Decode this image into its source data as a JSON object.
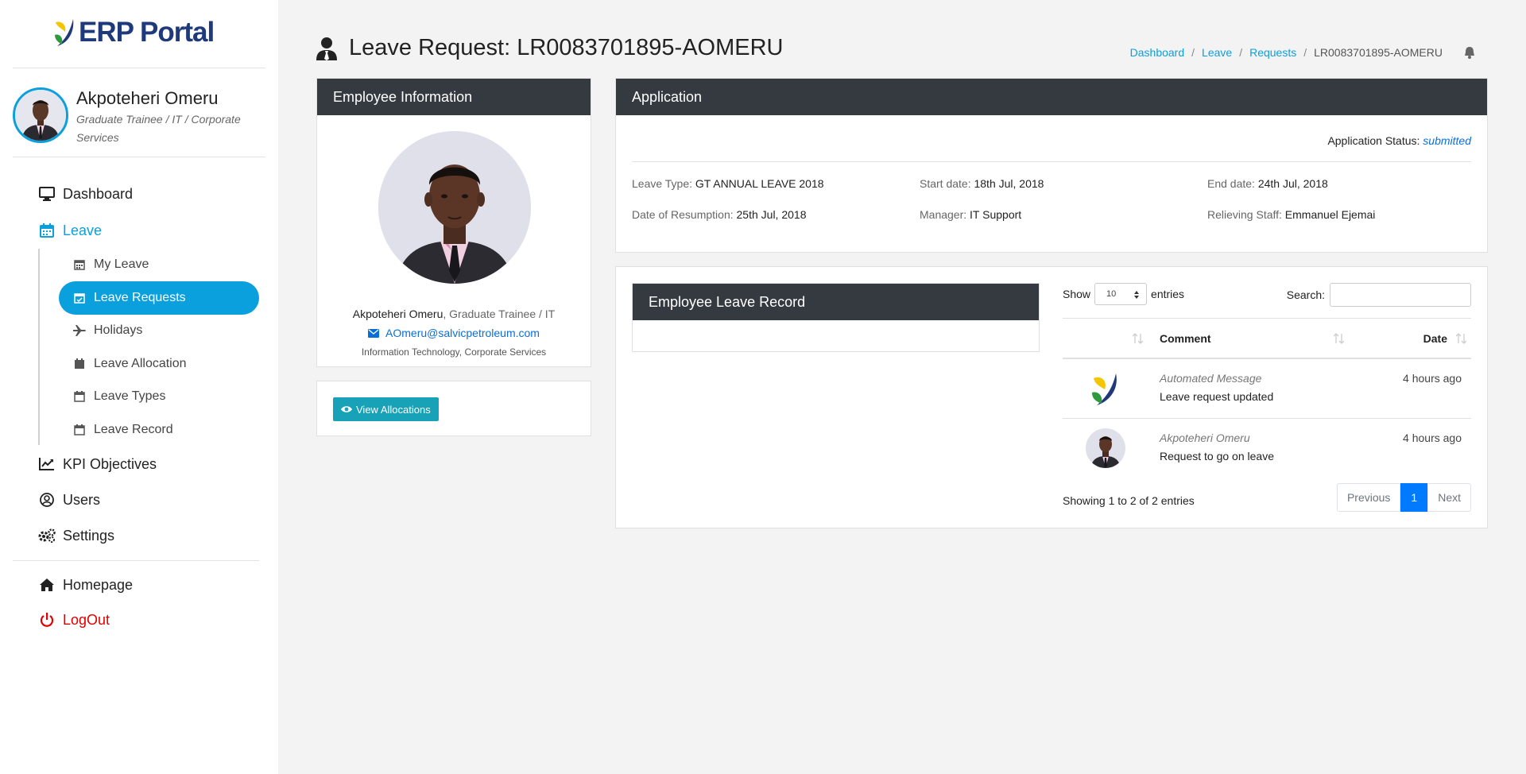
{
  "brand": {
    "name": "ERP Portal"
  },
  "user": {
    "name": "Akpoteheri Omeru",
    "role": "Graduate Trainee / IT / Corporate Services"
  },
  "nav": {
    "dashboard": "Dashboard",
    "leave": "Leave",
    "sub": {
      "my_leave": "My Leave",
      "leave_requests": "Leave Requests",
      "holidays": "Holidays",
      "leave_allocation": "Leave Allocation",
      "leave_types": "Leave Types",
      "leave_record": "Leave Record"
    },
    "kpi": "KPI Objectives",
    "users": "Users",
    "settings": "Settings",
    "homepage": "Homepage",
    "logout": "LogOut"
  },
  "page": {
    "title": "Leave Request: LR0083701895-AOMERU"
  },
  "breadcrumb": {
    "dashboard": "Dashboard",
    "leave": "Leave",
    "requests": "Requests",
    "current": "LR0083701895-AOMERU",
    "sep": "/"
  },
  "employee": {
    "header": "Employee Information",
    "name": "Akpoteheri Omeru",
    "title_suffix": ", Graduate Trainee / IT",
    "email": "AOmeru@salvicpetroleum.com",
    "department": "Information Technology, Corporate Services",
    "view_allocations": "View Allocations"
  },
  "application": {
    "header": "Application",
    "status_label": "Application Status:",
    "status_value": "submitted",
    "leave_type_label": "Leave Type:",
    "leave_type": "GT ANNUAL LEAVE 2018",
    "start_label": "Start date:",
    "start_date": "18th Jul, 2018",
    "end_label": "End date:",
    "end_date": "24th Jul, 2018",
    "resumption_label": "Date of Resumption:",
    "resumption_date": "25th Jul, 2018",
    "manager_label": "Manager:",
    "manager": "IT Support",
    "relieving_label": "Relieving Staff:",
    "relieving_staff": "Emmanuel Ejemai"
  },
  "record": {
    "header": "Employee Leave Record",
    "show_label": "Show",
    "entries_value": "10",
    "entries_label": "entries",
    "search_label": "Search:",
    "columns": {
      "comment": "Comment",
      "date": "Date"
    },
    "rows": [
      {
        "author": "Automated Message",
        "text": "Leave request updated",
        "date": "4 hours ago"
      },
      {
        "author": "Akpoteheri Omeru",
        "text": "Request to go on leave",
        "date": "4 hours ago"
      }
    ],
    "info": "Showing 1 to 2 of 2 entries",
    "pager": {
      "prev": "Previous",
      "page": "1",
      "next": "Next"
    }
  },
  "colors": {
    "accent": "#0aa0de",
    "dark_header": "#343a40",
    "logout": "#e00000",
    "link": "#0a6ed8",
    "button": "#17a2b8",
    "page_active": "#007bff"
  },
  "icons": [
    "monitor-icon",
    "calendar-icon",
    "calendar-check-icon",
    "plane-icon",
    "line-chart-icon",
    "user-circle-icon",
    "gears-icon",
    "home-icon",
    "power-icon",
    "user-tie-icon",
    "bell-icon",
    "envelope-icon",
    "eye-icon",
    "sort-icon"
  ]
}
